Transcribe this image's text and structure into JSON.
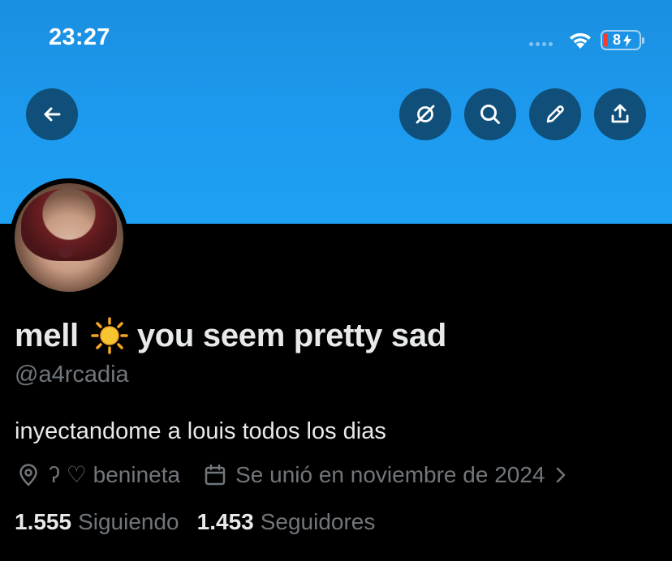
{
  "status_bar": {
    "time": "23:27",
    "battery": "8"
  },
  "header": {
    "buttons": [
      {
        "name": "back",
        "icon": "arrow-left-icon"
      },
      {
        "name": "grok",
        "icon": "grok-icon"
      },
      {
        "name": "search",
        "icon": "search-icon"
      },
      {
        "name": "edit",
        "icon": "pencil-icon"
      },
      {
        "name": "share",
        "icon": "share-icon"
      }
    ],
    "banner_color": "#1d9bf0"
  },
  "profile": {
    "display_name_before": "mell",
    "display_name_after": "you seem pretty sad",
    "handle": "@a4rcadia",
    "bio": "inyectandome a louis todos los dias",
    "location": "ʔ ♡ benineta",
    "joined": "Se unió en noviembre de 2024",
    "following_count": "1.555",
    "following_label": "Siguiendo",
    "followers_count": "1.453",
    "followers_label": "Seguidores"
  },
  "colors": {
    "background": "#000000",
    "primary_text": "#e7e9ea",
    "secondary_text": "#71767b",
    "button_bg": "#0f4f7a"
  }
}
